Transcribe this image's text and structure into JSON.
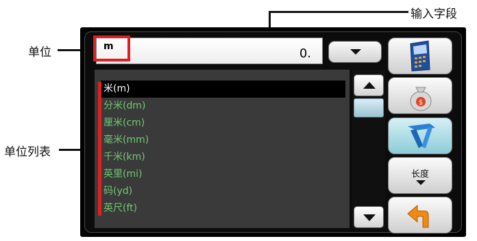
{
  "annotations": {
    "input_field": "输入字段",
    "unit": "单位",
    "unit_list": "单位列表"
  },
  "unit_field": {
    "unit_code": "m",
    "value": "0."
  },
  "unit_list": {
    "items": [
      "米(m)",
      "分米(dm)",
      "厘米(cm)",
      "毫米(mm)",
      "千米(km)",
      "英里(mi)",
      "码(yd)",
      "英尺(ft)"
    ],
    "selected_index": 0
  },
  "side_buttons": {
    "category_label": "长度"
  },
  "icons": {
    "dropdown": "chevron-down-icon",
    "scroll_up": "arrow-up-icon",
    "scroll_down": "arrow-down-icon",
    "calculator": "calculator-icon",
    "currency": "money-bag-icon",
    "unit_convert": "unit-convert-icon",
    "back": "back-arrow-icon"
  },
  "colors": {
    "list_item_text": "#72c872",
    "selected_item_bg": "#000000",
    "annotation_marker": "#e02020"
  }
}
